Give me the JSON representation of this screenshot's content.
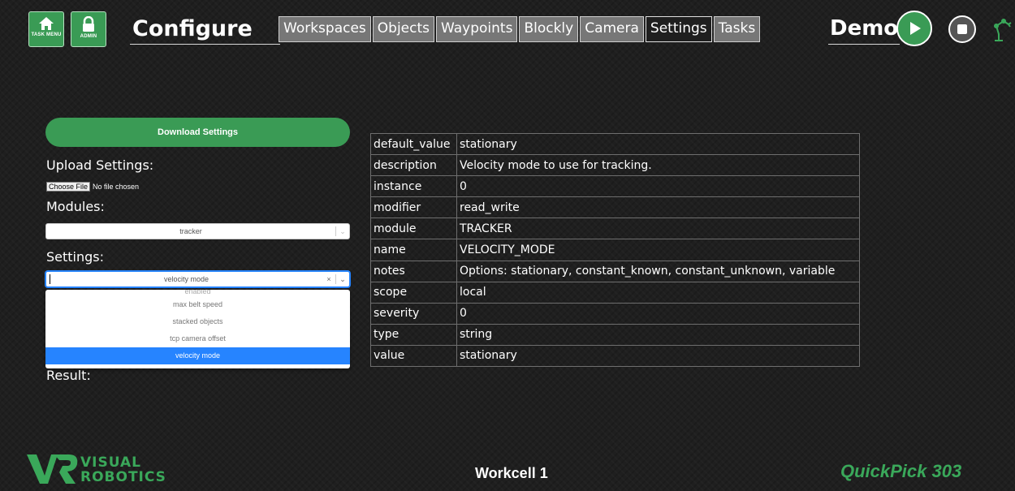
{
  "header": {
    "task_menu_label": "TASK MENU",
    "admin_label": "ADMIN",
    "title": "Configure",
    "tabs": [
      {
        "label": "Workspaces",
        "active": false
      },
      {
        "label": "Objects",
        "active": false
      },
      {
        "label": "Waypoints",
        "active": false
      },
      {
        "label": "Blockly",
        "active": false
      },
      {
        "label": "Camera",
        "active": false
      },
      {
        "label": "Settings",
        "active": true
      },
      {
        "label": "Tasks",
        "active": false
      }
    ],
    "mode": "Demo",
    "icons": {
      "task_menu": "home-icon",
      "admin": "lock-icon",
      "play": "play-icon",
      "stop": "stop-icon",
      "robot": "robot-arm-icon"
    }
  },
  "left_panel": {
    "download_label": "Download Settings",
    "upload_label": "Upload Settings:",
    "file_button": "Choose File",
    "file_status": "No file chosen",
    "modules_label": "Modules:",
    "modules_value": "tracker",
    "settings_label": "Settings:",
    "settings_value": "velocity mode",
    "settings_options": [
      {
        "label": "enabled",
        "selected": false
      },
      {
        "label": "max belt speed",
        "selected": false
      },
      {
        "label": "stacked objects",
        "selected": false
      },
      {
        "label": "tcp camera offset",
        "selected": false
      },
      {
        "label": "velocity mode",
        "selected": true
      }
    ],
    "result_label": "Result:",
    "clear_symbol": "×",
    "dropdown_symbol": "⌄"
  },
  "settings_table": [
    {
      "key": "default_value",
      "value": "stationary"
    },
    {
      "key": "description",
      "value": "Velocity mode to use for tracking."
    },
    {
      "key": "instance",
      "value": "0"
    },
    {
      "key": "modifier",
      "value": "read_write"
    },
    {
      "key": "module",
      "value": "TRACKER"
    },
    {
      "key": "name",
      "value": "VELOCITY_MODE"
    },
    {
      "key": "notes",
      "value": "Options: stationary, constant_known, constant_unknown, variable"
    },
    {
      "key": "scope",
      "value": "local"
    },
    {
      "key": "severity",
      "value": "0"
    },
    {
      "key": "type",
      "value": "string"
    },
    {
      "key": "value",
      "value": "stationary"
    }
  ],
  "footer": {
    "logo_line1": "VISUAL",
    "logo_line2": "ROBOTICS",
    "workcell": "Workcell 1",
    "product": "QuickPick 303"
  },
  "colors": {
    "accent_green": "#3a9b55",
    "product_green": "#3aa85a",
    "select_blue": "#2684ff",
    "background": "#1f1f1f"
  }
}
